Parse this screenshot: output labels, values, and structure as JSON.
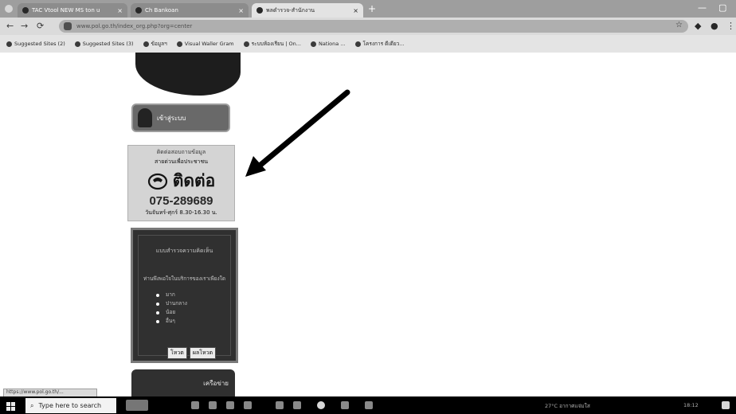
{
  "browser": {
    "tabs": [
      {
        "title": "TAC Vtool NEW MS ton u",
        "active": false
      },
      {
        "title": "Ch Bankoan",
        "active": false
      },
      {
        "title": "พลตำรวจ-สำนักงาน",
        "active": true
      }
    ],
    "url": "www.pol.go.th/index_org.php?org=center",
    "bookmarks": [
      "Suggested Sites (2)",
      "Suggested Sites (3)",
      "ข้อมูลฯ",
      "Visual Waller Gram",
      "ระบบห้องเรียน | On...",
      "Nationa ...",
      "โครงการ ดีเดียว..."
    ]
  },
  "page": {
    "login_button": "เข้าสู่ระบบ",
    "contact": {
      "line1": "ติดต่อสอบถามข้อมูล",
      "line2": "สายด่วนเพื่อประชาชน",
      "tel_label": "ติดต่อ",
      "number": "075-289689",
      "hours": "วันจันทร์-ศุกร์ 8.30-16.30 น."
    },
    "poll": {
      "title": "แบบสำรวจความคิดเห็น",
      "question": "ท่านพึงพอใจในบริการของเราเพียงใด",
      "options": [
        "มาก",
        "ปานกลาง",
        "น้อย",
        "อื่นๆ"
      ],
      "vote_label": "โหวต",
      "result_label": "ผลโหวต"
    },
    "banner_label": "เครือข่าย"
  },
  "status_url": "https://www.pol.go.th/...",
  "taskbar": {
    "search_placeholder": "Type here to search",
    "tray_weather": "27°C อากาศแจ่มใส",
    "clock": "18:12"
  }
}
